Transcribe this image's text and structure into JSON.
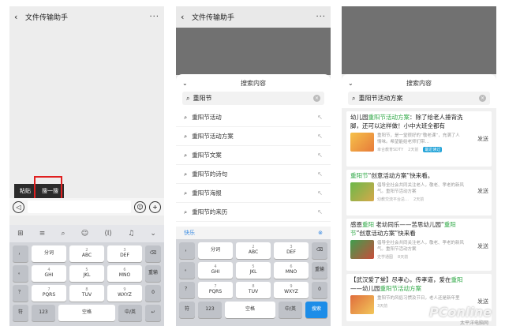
{
  "panel1": {
    "title": "文件传输助手",
    "context_menu": [
      "粘贴",
      "搜一搜"
    ]
  },
  "panel2": {
    "title": "文件传输助手",
    "sheet_title": "搜索内容",
    "query": "重阳节",
    "suggestions": [
      "重阳节活动",
      "重阳节活动方案",
      "重阳节文案",
      "重阳节的诗句",
      "重阳节海报",
      "重阳节的来历"
    ],
    "suggestion_bar": "快乐",
    "search_key": "搜索"
  },
  "panel3": {
    "sheet_title": "搜索内容",
    "query": "重阳节活动方案",
    "results": [
      {
        "title": "幼儿园重阳节活动方案：除了给老人捶背洗脚，还可以这样做！小中大班全都有",
        "desc": "重阳节，是一堂很好的“敬老课”，充满了人情味。希望能给老师们带…",
        "source": "幸合教育SDTY",
        "time": "2天前",
        "tag": "最近读过",
        "send": "发送"
      },
      {
        "title": "重阳节“创意活动方案”快来看。",
        "desc": "倡导全社会共同关注老人，敬老、孝老的新风气。重阳节活动方案",
        "source": "幼教交流平台总…",
        "time": "2天前",
        "send": "发送"
      },
      {
        "title": "感恩重阳 老幼同乐——苦思幼儿园“重阳节”创意活动方案”快来看",
        "desc": "倡导全社会共同关注老人，敬老、孝老的新风气。重阳节活动方案",
        "source": "史学通图",
        "time": "8天前",
        "send": "发送"
      },
      {
        "title": "【武汉爱了堂】尽孝心，传孝道，爱在重阳——幼儿园重阳节活动方案",
        "desc": "重阳节的风俗习惯及节日，老人还是新年里",
        "source": "",
        "time": "3天前",
        "send": "发送"
      }
    ]
  },
  "keyboard": {
    "row1": [
      {
        "main": "分词"
      },
      {
        "main": "ABC",
        "sub": "2"
      },
      {
        "main": "DEF",
        "sub": "3"
      }
    ],
    "row2": [
      {
        "main": "GHI",
        "sub": "4"
      },
      {
        "main": "JKL",
        "sub": "5"
      },
      {
        "main": "MNO",
        "sub": "6"
      }
    ],
    "row3": [
      {
        "main": "PQRS",
        "sub": "7"
      },
      {
        "main": "TUV",
        "sub": "8"
      },
      {
        "main": "WXYZ",
        "sub": "9"
      }
    ],
    "left_col": [
      "，",
      "。",
      "？",
      "！"
    ],
    "right_col": [
      "⌫",
      "重输",
      "0",
      "↵"
    ],
    "bottom": [
      "符",
      "123",
      "空格",
      "中/英",
      "↵"
    ],
    "reenter": "重输"
  },
  "watermark": "PConline",
  "watermark_sub": "太平洋电脑网"
}
